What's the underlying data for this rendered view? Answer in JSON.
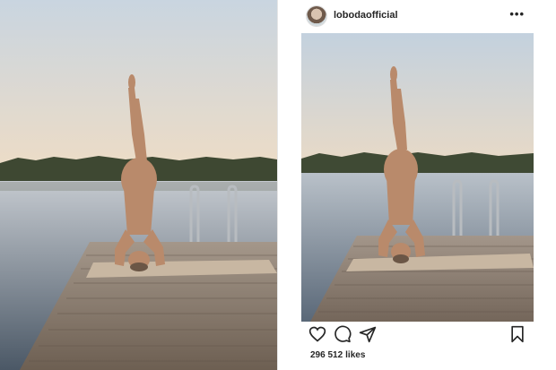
{
  "post": {
    "username": "lobodaofficial",
    "more_icon": "more-horizontal-icon",
    "likes_count": "296 512",
    "likes_label": "likes",
    "actions": [
      "heart-icon",
      "comment-icon",
      "share-icon",
      "bookmark-icon"
    ]
  },
  "colors": {
    "sky_top": "#c7d3df",
    "sky_bottom": "#eadbc6",
    "water": "#6f7e8e",
    "trees": "#3f4a34",
    "dock": "#8f7f6f",
    "mat": "#c9b8a4"
  }
}
